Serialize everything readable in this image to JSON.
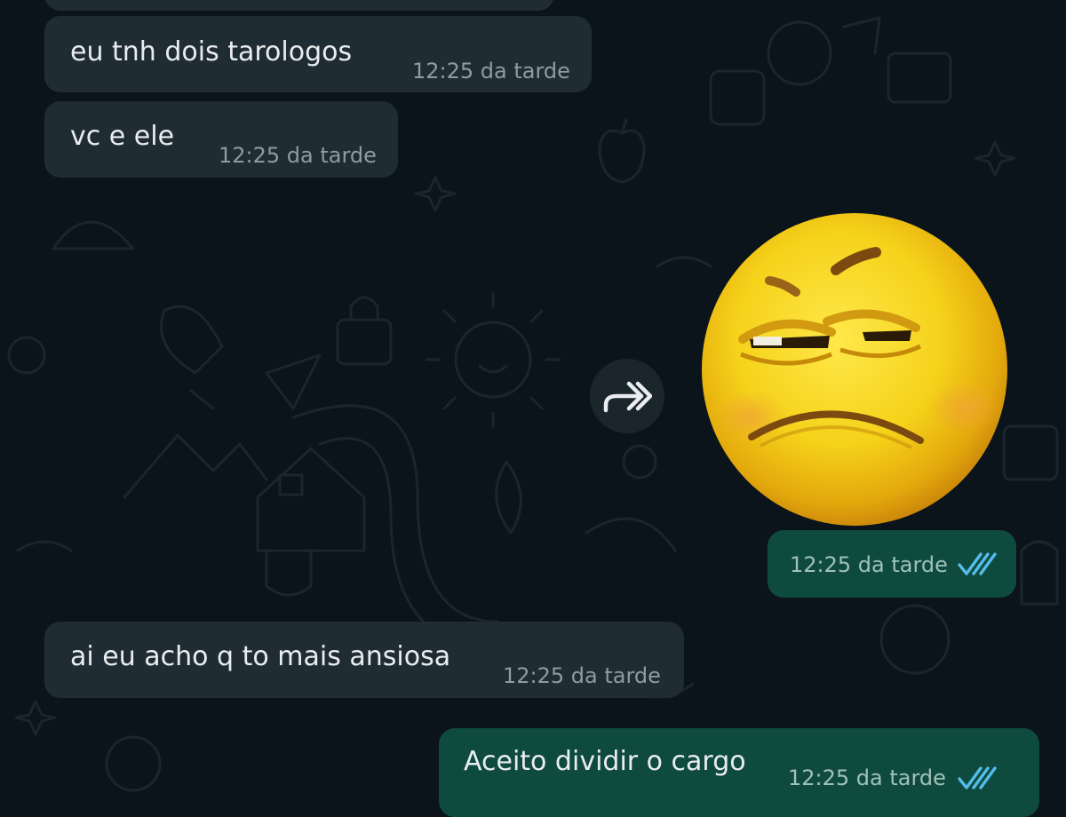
{
  "messages": [
    {
      "direction": "incoming",
      "text": "eu tnh dois tarologos",
      "time": "12:25 da tarde"
    },
    {
      "direction": "incoming",
      "text": "vc e ele",
      "time": "12:25 da tarde"
    },
    {
      "direction": "outgoing",
      "type": "sticker",
      "sticker": "annoyed-yellow-face",
      "time": "12:25 da tarde",
      "status": "read"
    },
    {
      "direction": "incoming",
      "text": "ai eu acho q to mais ansiosa",
      "time": "12:25 da tarde"
    },
    {
      "direction": "outgoing",
      "text": "Aceito dividir o cargo",
      "time": "12:25 da tarde",
      "status": "read"
    }
  ],
  "icons": {
    "forward": "forward-icon",
    "read_receipt": "double-check-icon"
  },
  "colors": {
    "background": "#0b141a",
    "incoming_bubble": "#202c33",
    "outgoing_bubble": "#0f4a3e",
    "read_ticks": "#53bdeb"
  }
}
